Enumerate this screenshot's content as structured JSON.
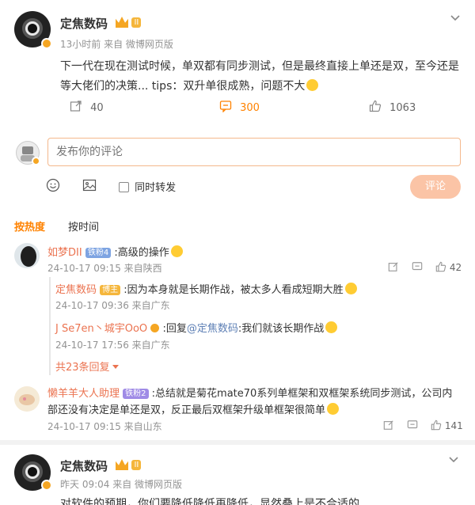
{
  "post1": {
    "author": "定焦数码",
    "meta": "13小时前 来自 微博网页版",
    "text": "下一代在现在测试时候，单双都有同步测试，但是最终直接上单还是双，至今还是等大佬们的决策... tips：双升单很成熟，问题不大",
    "share_count": "40",
    "comment_count": "300",
    "like_count": "1063",
    "badge_label": "II"
  },
  "composer": {
    "placeholder": "发布你的评论",
    "repost_label": "同时转发",
    "submit_label": "评论"
  },
  "sort_tabs": {
    "hot": "按热度",
    "time": "按时间"
  },
  "comments": [
    {
      "name": "如梦DII",
      "level": "铁粉4",
      "text": ":高级的操作",
      "meta": "24-10-17 09:15 来自陕西",
      "like": "42"
    },
    {
      "name": "懒羊羊大人助理",
      "level": "铁粉2",
      "text": ":总结就是菊花mate70系列单框架和双框架系统同步测试，公司内部还没有决定是单还是双，反正最后双框架升级单框架很简单",
      "meta": "24-10-17 09:15 来自山东",
      "like": "141"
    }
  ],
  "replies": [
    {
      "name": "定焦数码",
      "tag": "博主",
      "text": ":因为本身就是长期作战，被太多人看成短期大胜",
      "meta": "24-10-17 09:36 来自广东"
    },
    {
      "name": "J Se7en丶城宇OoO",
      "prefix": ":回复",
      "mention": "@定焦数码",
      "text": ":我们就该长期作战",
      "meta": "24-10-17 17:56 来自广东"
    }
  ],
  "more_replies": "共23条回复",
  "post2": {
    "author": "定焦数码",
    "meta": "昨天 09:04 来自 微博网页版",
    "text": "对软件的预期，你们要降低降低再降低，显然叠上是不合适的"
  },
  "colors": {
    "accent": "#ff8200",
    "link": "#eb7350",
    "blue": "#5d7fb5",
    "submit_bg": "#fbc4a6"
  }
}
